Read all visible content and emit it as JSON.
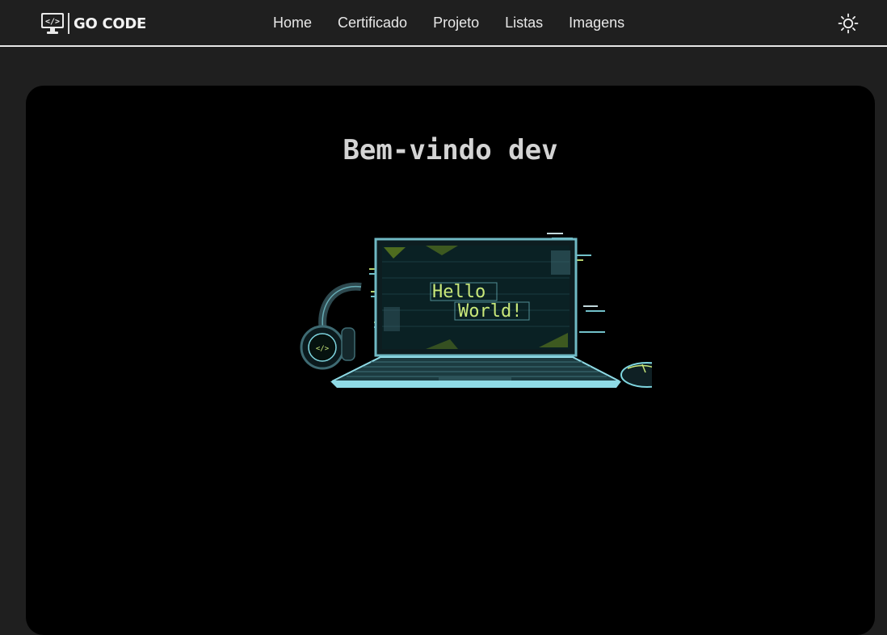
{
  "brand": {
    "logo_icon": "monitor-code-icon",
    "logo_glyph": "</>",
    "name": "GO CODE"
  },
  "nav": {
    "items": [
      {
        "label": "Home"
      },
      {
        "label": "Certificado"
      },
      {
        "label": "Projeto"
      },
      {
        "label": "Listas"
      },
      {
        "label": "Imagens"
      }
    ],
    "theme_toggle_icon": "sun-icon"
  },
  "hero": {
    "title": "Bem-vindo dev",
    "illustration": {
      "screen_line_1": "Hello",
      "screen_line_2": "World!"
    }
  },
  "colors": {
    "background": "#1f1f1f",
    "hero_background": "#000000",
    "nav_text": "#e8e8e8",
    "accent_cyan": "#7fd6e0",
    "accent_lime": "#c9e87a"
  }
}
